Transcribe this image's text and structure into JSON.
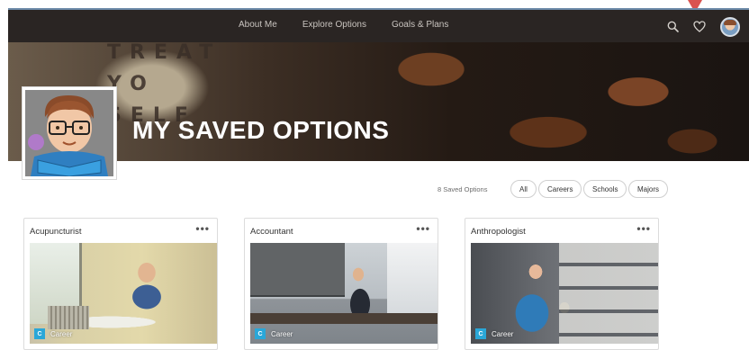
{
  "nav": {
    "links": [
      "About Me",
      "Explore Options",
      "Goals & Plans"
    ]
  },
  "hero": {
    "sign_text": "TREAT\nYO\nSELF",
    "title": "MY SAVED OPTIONS"
  },
  "filters": {
    "saved_count": "8 Saved Options",
    "chips": [
      "All",
      "Careers",
      "Schools",
      "Majors"
    ]
  },
  "cards": [
    {
      "title": "Acupuncturist",
      "menu": "•••",
      "tag_letter": "C",
      "tag_label": "Career"
    },
    {
      "title": "Accountant",
      "menu": "•••",
      "tag_letter": "C",
      "tag_label": "Career"
    },
    {
      "title": "Anthropologist",
      "menu": "•••",
      "tag_letter": "C",
      "tag_label": "Career"
    }
  ],
  "colors": {
    "nav_bg": "#2a2523",
    "tag_accent": "#2aa7d8",
    "pointer_arrow": "#d9534f"
  },
  "icons": [
    "search-icon",
    "heart-icon",
    "user-avatar",
    "more-options-icon"
  ]
}
